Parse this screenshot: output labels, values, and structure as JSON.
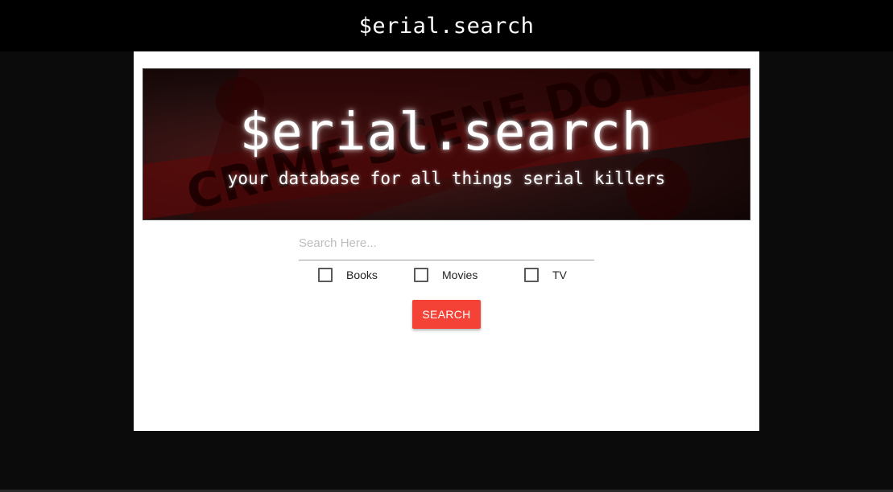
{
  "header": {
    "title": "$erial.search"
  },
  "banner": {
    "title": "$erial.search",
    "subtitle": "your database for all things serial killers",
    "tape_text": "CRIME SCENE DO NOT CROSS"
  },
  "search": {
    "placeholder": "Search Here...",
    "value": ""
  },
  "filters": [
    {
      "label": "Books",
      "checked": false
    },
    {
      "label": "Movies",
      "checked": false
    },
    {
      "label": "TV",
      "checked": false
    }
  ],
  "search_button": {
    "label": "SEARCH"
  },
  "colors": {
    "background": "#0b0b0b",
    "header": "#000000",
    "card": "#ffffff",
    "button": "#f44336"
  }
}
